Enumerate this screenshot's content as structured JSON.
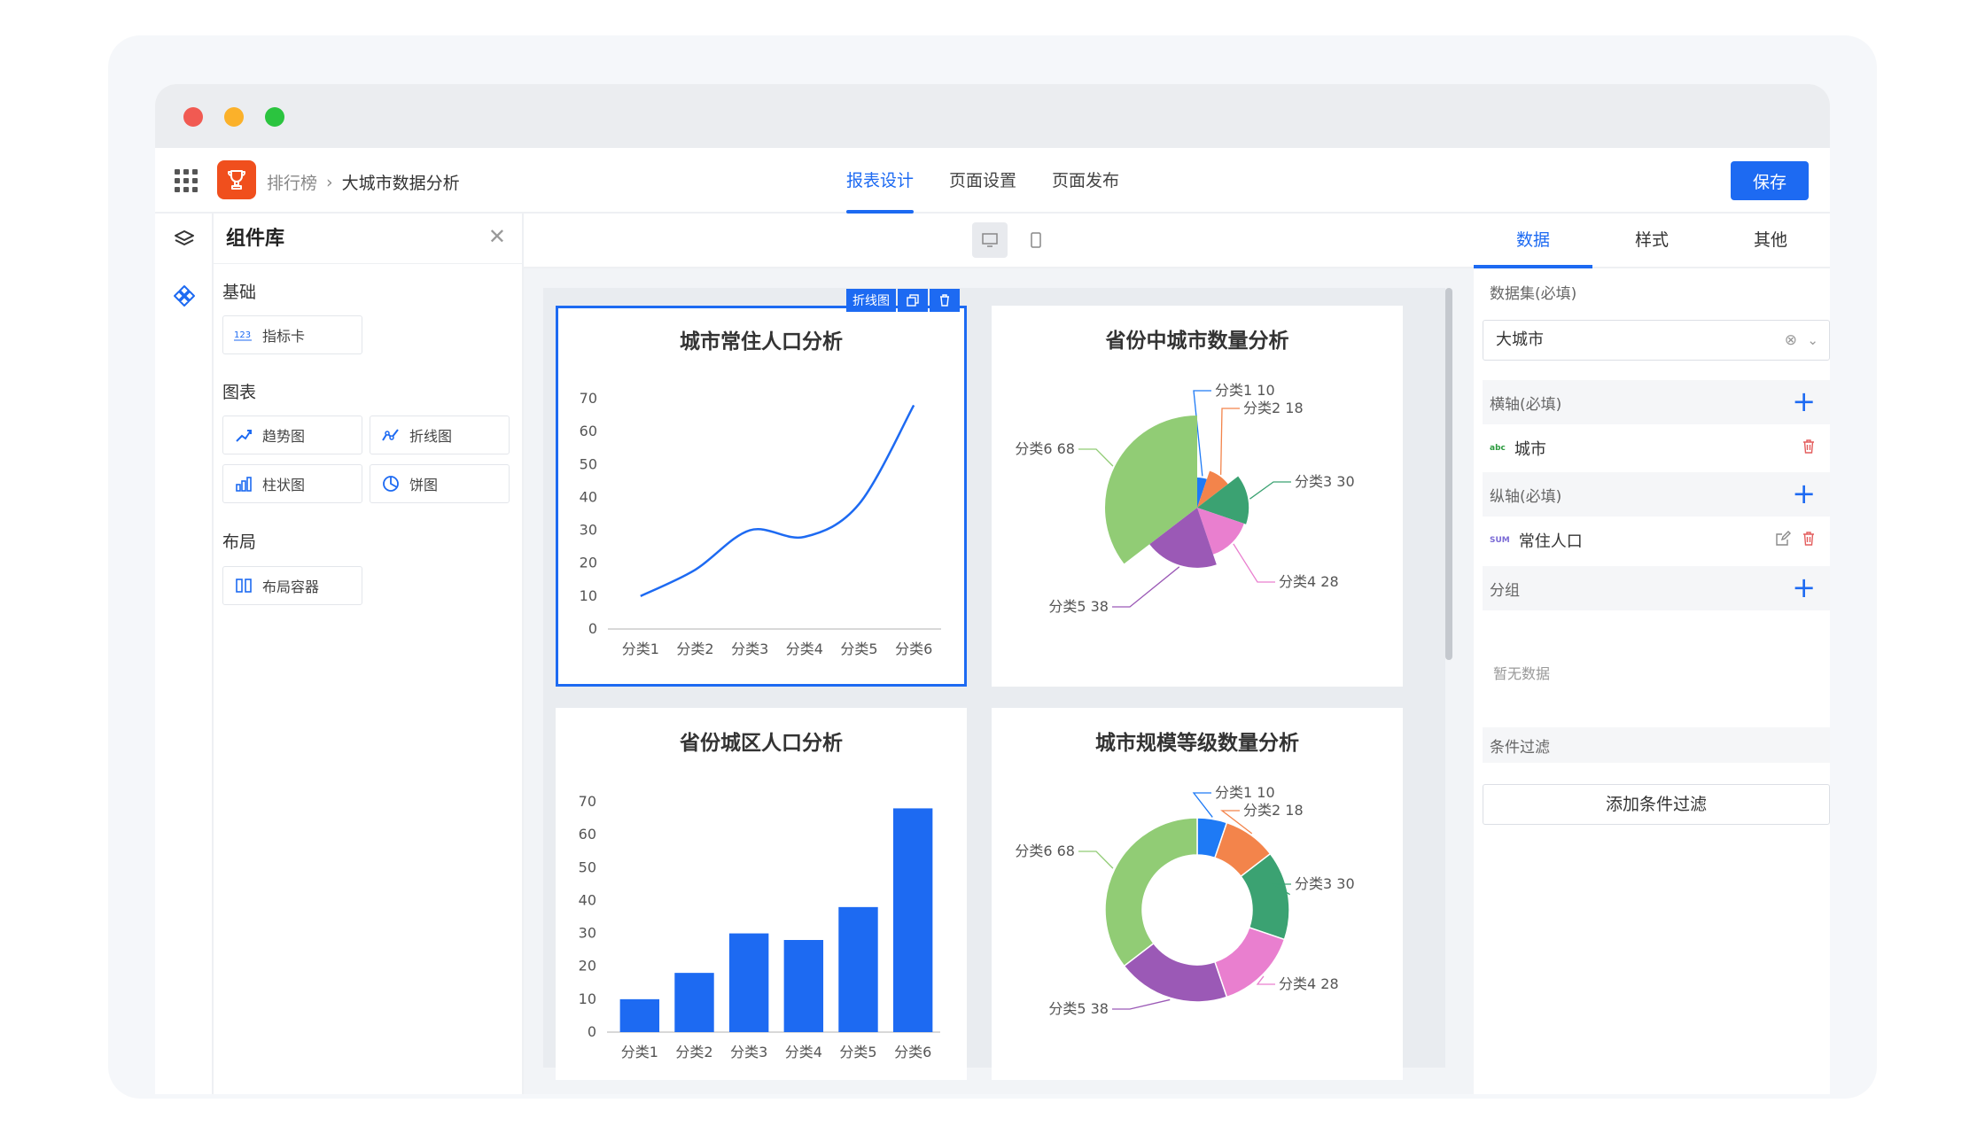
{
  "breadcrumb": {
    "parent": "排行榜",
    "current": "大城市数据分析"
  },
  "tabs": [
    {
      "label": "报表设计",
      "active": true
    },
    {
      "label": "页面设置"
    },
    {
      "label": "页面发布"
    }
  ],
  "save_label": "保存",
  "library": {
    "title": "组件库",
    "sections": [
      {
        "title": "基础",
        "items": [
          {
            "label": "指标卡",
            "icon": "metric-card-icon"
          }
        ]
      },
      {
        "title": "图表",
        "items": [
          {
            "label": "趋势图",
            "icon": "trend-chart-icon"
          },
          {
            "label": "折线图",
            "icon": "line-chart-icon"
          },
          {
            "label": "柱状图",
            "icon": "bar-chart-icon"
          },
          {
            "label": "饼图",
            "icon": "pie-chart-icon"
          }
        ]
      },
      {
        "title": "布局",
        "items": [
          {
            "label": "布局容器",
            "icon": "layout-container-icon"
          }
        ]
      }
    ]
  },
  "selected_tag": "折线图",
  "right_panel": {
    "tabs": [
      "数据",
      "样式",
      "其他"
    ],
    "dataset_label": "数据集(必填)",
    "dataset_value": "大城市",
    "x_axis_label": "横轴(必填)",
    "x_field": {
      "tag": "abc",
      "name": "城市"
    },
    "y_axis_label": "纵轴(必填)",
    "y_field": {
      "tag": "SUM",
      "name": "常住人口"
    },
    "group_label": "分组",
    "group_empty": "暂无数据",
    "filter_label": "条件过滤",
    "add_filter": "添加条件过滤"
  },
  "colors": {
    "accent": "#1d6af2",
    "pie": [
      "#1e7af5",
      "#f3844b",
      "#3ba272",
      "#e97fcf",
      "#9b59b6",
      "#91cc75"
    ]
  },
  "chart_data": [
    {
      "type": "line",
      "title": "城市常住人口分析",
      "categories": [
        "分类1",
        "分类2",
        "分类3",
        "分类4",
        "分类5",
        "分类6"
      ],
      "values": [
        10,
        18,
        30,
        28,
        38,
        68
      ],
      "ylim": [
        0,
        70
      ],
      "yticks": [
        0,
        10,
        20,
        30,
        40,
        50,
        60,
        70
      ]
    },
    {
      "type": "pie",
      "variant": "rose",
      "title": "省份中城市数量分析",
      "labels": [
        "分类1",
        "分类2",
        "分类3",
        "分类4",
        "分类5",
        "分类6"
      ],
      "values": [
        10,
        18,
        30,
        28,
        38,
        68
      ]
    },
    {
      "type": "bar",
      "title": "省份城区人口分析",
      "categories": [
        "分类1",
        "分类2",
        "分类3",
        "分类4",
        "分类5",
        "分类6"
      ],
      "values": [
        10,
        18,
        30,
        28,
        38,
        68
      ],
      "ylim": [
        0,
        70
      ],
      "yticks": [
        0,
        10,
        20,
        30,
        40,
        50,
        60,
        70
      ]
    },
    {
      "type": "pie",
      "variant": "donut",
      "title": "城市规模等级数量分析",
      "labels": [
        "分类1",
        "分类2",
        "分类3",
        "分类4",
        "分类5",
        "分类6"
      ],
      "values": [
        10,
        18,
        30,
        28,
        38,
        68
      ]
    }
  ]
}
